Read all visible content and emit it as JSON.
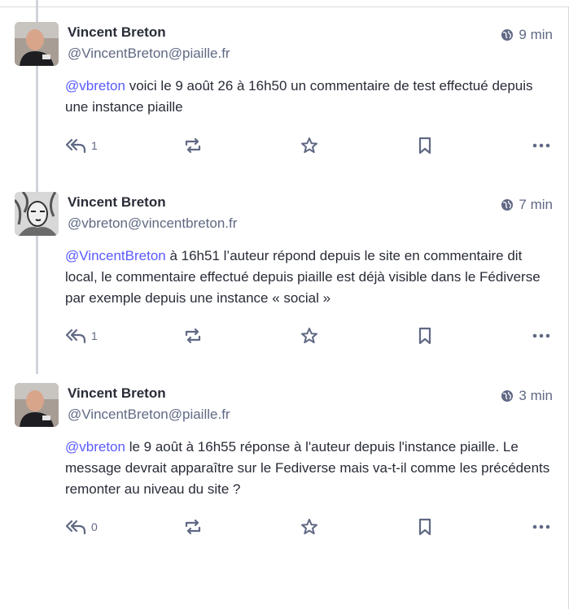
{
  "posts": [
    {
      "name": "Vincent Breton",
      "handle": "@VincentBreton@piaille.fr",
      "time": "9 min",
      "mention": "@vbreton",
      "text": " voici le 9 août 26 à 16h50 un commentaire de test effectué depuis une instance piaille",
      "reply_count": "1",
      "avatar": "bald-man"
    },
    {
      "name": "Vincent Breton",
      "handle": "@vbreton@vincentbreton.fr",
      "time": "7 min",
      "mention": "@VincentBreton",
      "text": " à 16h51 l’auteur répond depuis le site en commentaire dit local, le commentaire effectué depuis piaille est déjà visible dans le Fédiverse par exemple depuis une instance « social »",
      "reply_count": "1",
      "avatar": "sketch-portrait"
    },
    {
      "name": "Vincent Breton",
      "handle": "@VincentBreton@piaille.fr",
      "time": "3 min",
      "mention": "@vbreton",
      "text": " le 9 août à 16h55 réponse à l'auteur depuis l'instance piaille. Le message devrait apparaître sur le Fediverse mais va-t-il comme les précédents remonter au niveau du site ?",
      "reply_count": "0",
      "avatar": "bald-man"
    }
  ],
  "colors": {
    "mention": "#595aff",
    "muted": "#606984",
    "text": "#282c37"
  }
}
